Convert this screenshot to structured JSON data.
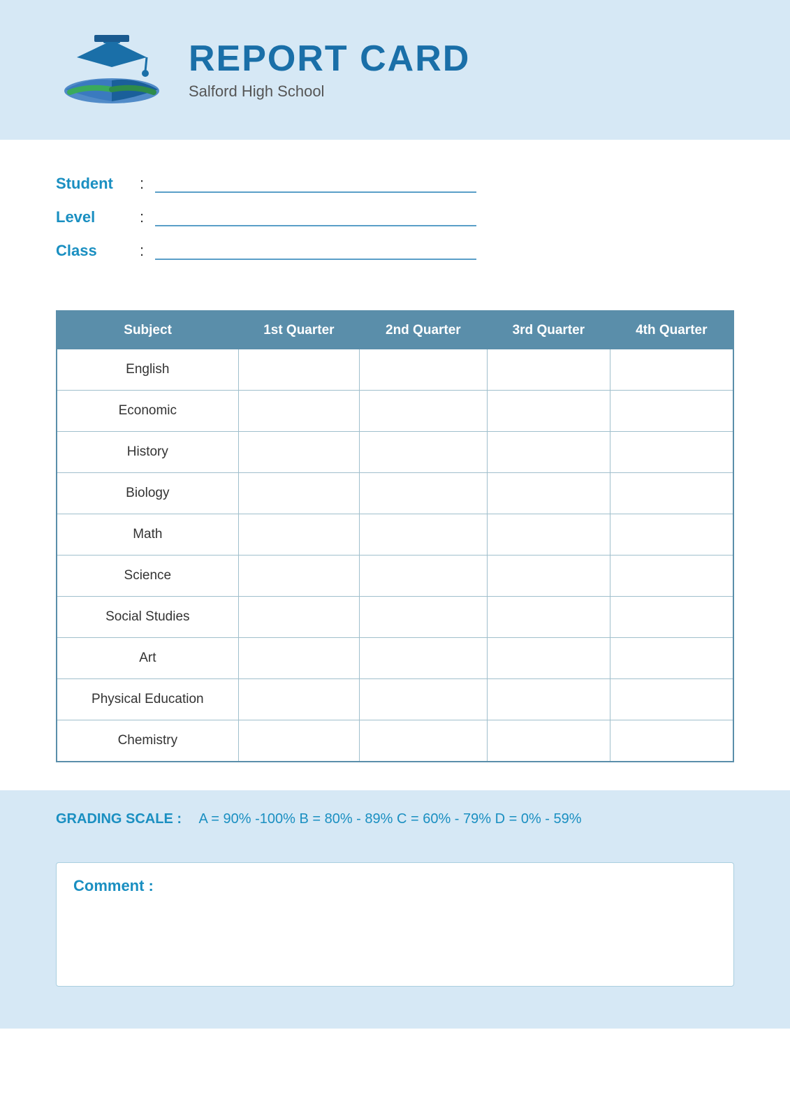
{
  "header": {
    "title": "REPORT CARD",
    "school": "Salford High School"
  },
  "student_info": {
    "student_label": "Student",
    "level_label": "Level",
    "class_label": "Class",
    "colon": ":"
  },
  "table": {
    "headers": [
      "Subject",
      "1st Quarter",
      "2nd Quarter",
      "3rd Quarter",
      "4th Quarter"
    ],
    "rows": [
      {
        "subject": "English"
      },
      {
        "subject": "Economic"
      },
      {
        "subject": "History"
      },
      {
        "subject": "Biology"
      },
      {
        "subject": "Math"
      },
      {
        "subject": "Science"
      },
      {
        "subject": "Social Studies"
      },
      {
        "subject": "Art"
      },
      {
        "subject": "Physical Education"
      },
      {
        "subject": "Chemistry"
      }
    ]
  },
  "grading": {
    "label": "GRADING SCALE :",
    "values": "A = 90% -100%  B = 80% - 89%  C = 60% - 79%  D = 0% - 59%"
  },
  "comment": {
    "label": "Comment :"
  }
}
